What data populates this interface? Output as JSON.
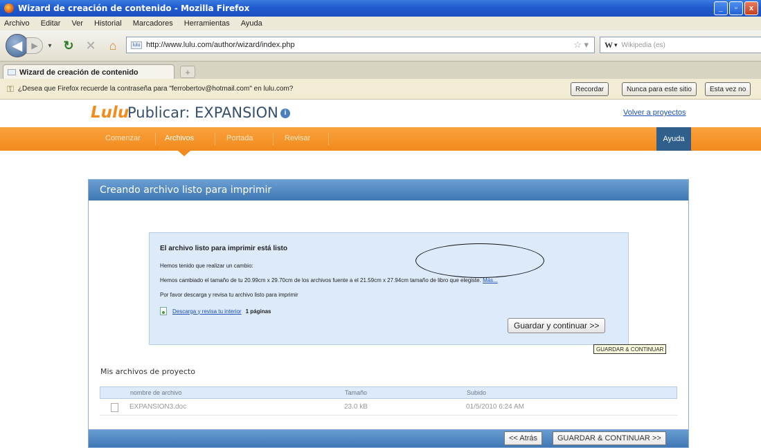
{
  "window": {
    "title": "Wizard de creación de contenido - Mozilla Firefox",
    "buttons": [
      "_",
      "▫",
      "x"
    ]
  },
  "menu": [
    "Archivo",
    "Editar",
    "Ver",
    "Historial",
    "Marcadores",
    "Herramientas",
    "Ayuda"
  ],
  "nav": {
    "url": "http://www.lulu.com/author/wizard/index.php",
    "favicon": "lulu",
    "search_engine": "W",
    "search_placeholder": "Wikipedia (es)"
  },
  "tab": {
    "label": "Wizard de creación de contenido",
    "new_tab": "+"
  },
  "notification": {
    "text": "¿Desea que Firefox recuerde la contraseña para \"ferrobertov@hotmail.com\" en lulu.com?",
    "buttons": [
      "Recordar",
      "Nunca para este sitio",
      "Esta vez no"
    ]
  },
  "site": {
    "logo": "Lulu",
    "logo_dot": ".",
    "title": "Publicar: EXPANSION",
    "back_link": "Volver a proyectos",
    "nav": [
      "Comenzar",
      "Archivos",
      "Portada",
      "Revisar"
    ],
    "active_nav": "Archivos",
    "help": "Ayuda"
  },
  "panel": {
    "heading": "Creando archivo listo para imprimir",
    "ready_title": "El archivo listo para imprimir está listo",
    "change_note": "Hemos tenido que realizar un cambio:",
    "change_detail": "Hemos cambiado el tamaño de tu 20.99cm x 29.70cm de los archivos fuente a el 21.59cm x 27.94cm tamaño de libro que elegiste.",
    "more_link": "Más...",
    "review_note": "Por favor descarga y revisa tu archivo listo para imprimir",
    "download_link": "Descarga y revisa tu interior",
    "pages": "1 páginas",
    "save_button": "Guardar y continuar >>",
    "tooltip": "GUARDAR & CONTINUAR"
  },
  "files": {
    "title": "Mis archivos de proyecto",
    "columns": [
      "nombre de archivo",
      "Tamaño",
      "Subido"
    ],
    "rows": [
      {
        "name": "EXPANSION3.doc",
        "size": "23.0 kB",
        "uploaded": "01/5/2010 6:24 AM"
      }
    ]
  },
  "footer": {
    "back": "<< Atrás",
    "save": "GUARDAR & CONTINUAR >>"
  },
  "colors": {
    "accent_orange": "#f28a1c",
    "panel_blue": "#3f77b5",
    "title_blue": "#1f5bd0",
    "link_blue": "#1b4fb5"
  }
}
